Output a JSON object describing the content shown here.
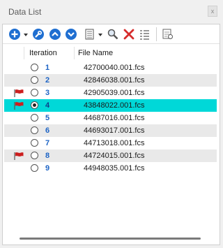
{
  "window": {
    "title": "Data List",
    "close_label": "x"
  },
  "toolbar": {
    "buttons": [
      {
        "icon": "add-icon",
        "color": "#1f6fd1"
      },
      {
        "icon": "dropdown-arrow-icon"
      },
      {
        "icon": "wrench-icon",
        "color": "#1f6fd1"
      },
      {
        "icon": "move-up-icon",
        "color": "#1f6fd1"
      },
      {
        "icon": "move-down-icon",
        "color": "#1f6fd1"
      },
      {
        "icon": "columns-icon"
      },
      {
        "icon": "dropdown-arrow-icon"
      },
      {
        "icon": "search-icon"
      },
      {
        "icon": "delete-icon",
        "color": "#d62c2c"
      },
      {
        "icon": "list-settings-icon"
      },
      {
        "icon": "report-icon"
      }
    ]
  },
  "table": {
    "columns": [
      "Iteration",
      "File Name"
    ],
    "rows": [
      {
        "iteration": "1",
        "file": "42700040.001.fcs",
        "flag": false,
        "selected": false
      },
      {
        "iteration": "2",
        "file": "42846038.001.fcs",
        "flag": false,
        "selected": false
      },
      {
        "iteration": "3",
        "file": "42905039.001.fcs",
        "flag": true,
        "selected": false
      },
      {
        "iteration": "4",
        "file": "43848022.001.fcs",
        "flag": true,
        "selected": true
      },
      {
        "iteration": "5",
        "file": "44687016.001.fcs",
        "flag": false,
        "selected": false
      },
      {
        "iteration": "6",
        "file": "44693017.001.fcs",
        "flag": false,
        "selected": false
      },
      {
        "iteration": "7",
        "file": "44713018.001.fcs",
        "flag": false,
        "selected": false
      },
      {
        "iteration": "8",
        "file": "44724015.001.fcs",
        "flag": true,
        "selected": false
      },
      {
        "iteration": "9",
        "file": "44948035.001.fcs",
        "flag": false,
        "selected": false
      }
    ]
  },
  "colors": {
    "selected_row": "#00d8d8",
    "flag": "#cc1f1f",
    "iteration_text": "#1c63c5"
  }
}
